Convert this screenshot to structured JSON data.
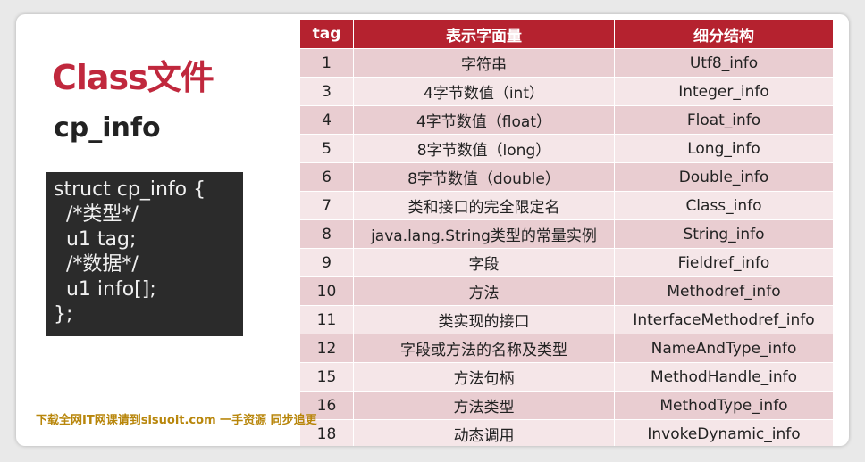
{
  "title": "Class文件",
  "subtitle": "cp_info",
  "code": {
    "line1": "struct cp_info {",
    "line2": "  /*类型*/",
    "line3": "  u1 tag;",
    "line4": "  /*数据*/",
    "line5": "  u1 info[];",
    "line6": "};"
  },
  "watermark": "下载全网IT网课请到sisuoit.com 一手资源 同步追更",
  "table": {
    "headers": [
      "tag",
      "表示字面量",
      "细分结构"
    ],
    "rows": [
      [
        "1",
        "字符串",
        "Utf8_info"
      ],
      [
        "3",
        "4字节数值（int）",
        "Integer_info"
      ],
      [
        "4",
        "4字节数值（float）",
        "Float_info"
      ],
      [
        "5",
        "8字节数值（long）",
        "Long_info"
      ],
      [
        "6",
        "8字节数值（double）",
        "Double_info"
      ],
      [
        "7",
        "类和接口的完全限定名",
        "Class_info"
      ],
      [
        "8",
        "java.lang.String类型的常量实例",
        "String_info"
      ],
      [
        "9",
        "字段",
        "Fieldref_info"
      ],
      [
        "10",
        "方法",
        "Methodref_info"
      ],
      [
        "11",
        "类实现的接口",
        "InterfaceMethodref_info"
      ],
      [
        "12",
        "字段或方法的名称及类型",
        "NameAndType_info"
      ],
      [
        "15",
        "方法句柄",
        "MethodHandle_info"
      ],
      [
        "16",
        "方法类型",
        "MethodType_info"
      ],
      [
        "18",
        "动态调用",
        "InvokeDynamic_info"
      ]
    ]
  }
}
